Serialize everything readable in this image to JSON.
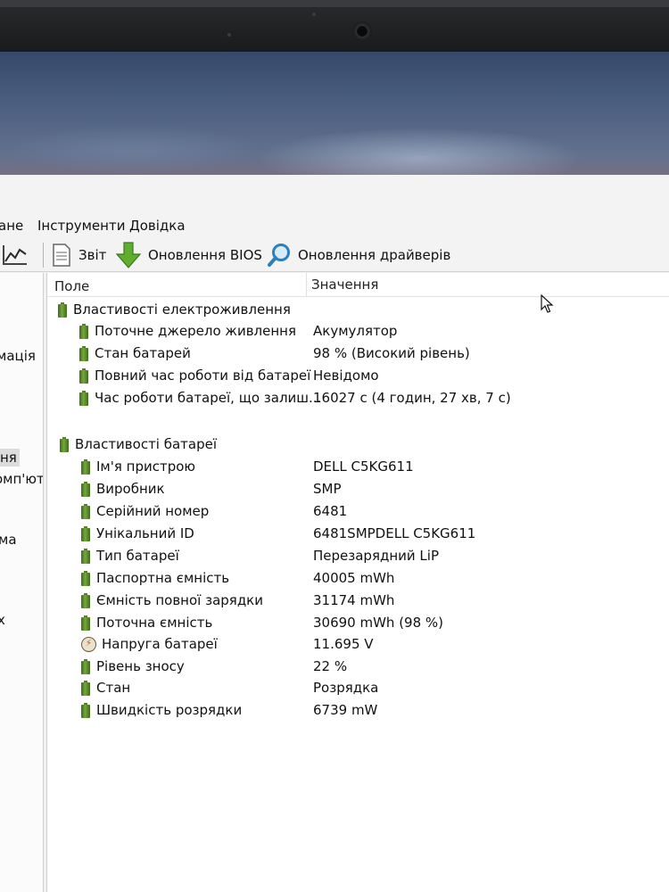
{
  "menu": [
    "ане",
    "Інструменти",
    "Довідка"
  ],
  "toolbar": {
    "report": "Звіт",
    "bios_update": "Оновлення BIOS",
    "driver_update": "Оновлення драйверів"
  },
  "left_pane": [
    "мація",
    "",
    "ня",
    "омп'ют",
    "ма",
    "х"
  ],
  "columns": {
    "field": "Поле",
    "value": "Значення"
  },
  "power_group": {
    "title": "Властивості електроживлення",
    "rows": [
      {
        "field": "Поточне джерело живлення",
        "value": "Акумулятор"
      },
      {
        "field": "Стан батарей",
        "value": "98 % (Високий рівень)"
      },
      {
        "field": "Повний час роботи від батареї",
        "value": "Невідомо"
      },
      {
        "field": "Час роботи батареї, що залиш...",
        "value": "16027 с (4 годин, 27 хв, 7 с)"
      }
    ]
  },
  "battery_group": {
    "title": "Властивості батареї",
    "rows": [
      {
        "field": "Ім'я пристрою",
        "value": "DELL C5KG611"
      },
      {
        "field": "Виробник",
        "value": "SMP"
      },
      {
        "field": "Серійний номер",
        "value": "6481"
      },
      {
        "field": "Унікальний ID",
        "value": "6481SMPDELL C5KG611"
      },
      {
        "field": "Тип батареї",
        "value": "Перезарядний LiP"
      },
      {
        "field": "Паспортна ємність",
        "value": "40005 mWh"
      },
      {
        "field": "Ємність повної зарядки",
        "value": "31174 mWh"
      },
      {
        "field": "Поточна ємність",
        "value": "30690 mWh  (98 %)"
      },
      {
        "field": "Напруга батареї",
        "value": "11.695 V"
      },
      {
        "field": "Рівень зносу",
        "value": "22 %"
      },
      {
        "field": "Стан",
        "value": "Розрядка"
      },
      {
        "field": "Швидкість розрядки",
        "value": "6739 mW"
      }
    ]
  },
  "icons": {
    "battery": "battery-icon",
    "voltage": "voltage-bolt-icon",
    "report": "report-page-icon",
    "bios": "green-down-arrow-icon",
    "drivers": "magnifier-icon",
    "chart": "line-chart-icon"
  }
}
